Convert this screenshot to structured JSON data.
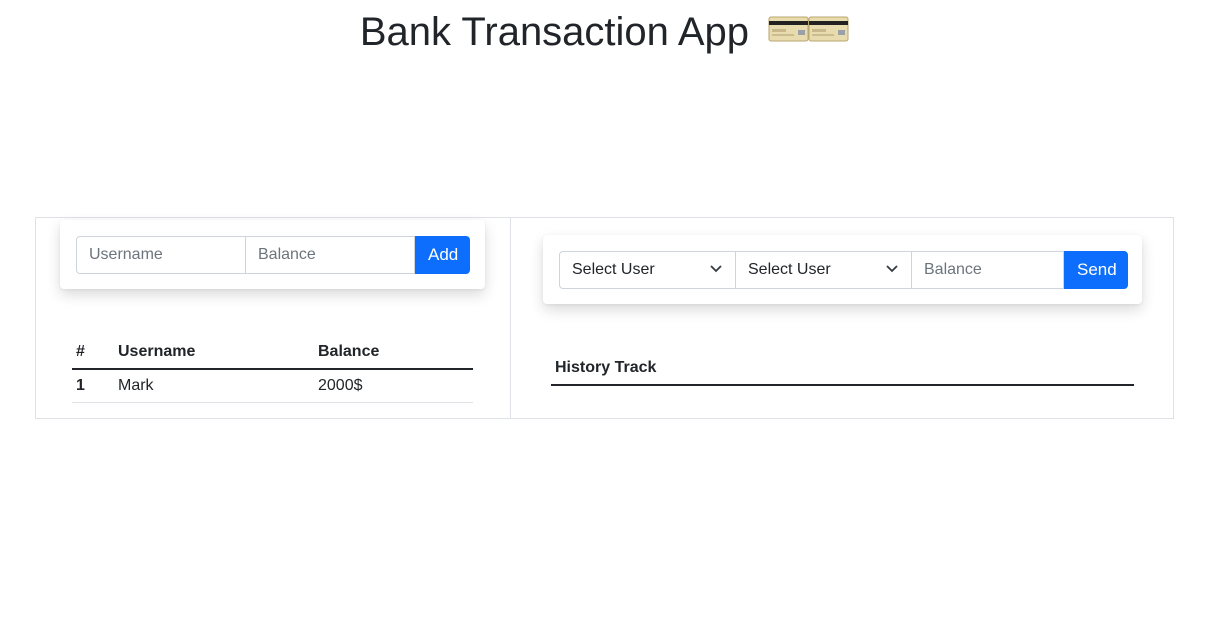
{
  "app": {
    "title": "Bank Transaction App",
    "title_icon": "credit-card-icon"
  },
  "add_form": {
    "username_placeholder": "Username",
    "balance_placeholder": "Balance",
    "add_label": "Add"
  },
  "users_table": {
    "headers": [
      "#",
      "Username",
      "Balance"
    ],
    "rows": [
      {
        "index": "1",
        "username": "Mark",
        "balance": "2000$"
      }
    ]
  },
  "send_form": {
    "from_select": "Select User",
    "to_select": "Select User",
    "balance_placeholder": "Balance",
    "send_label": "Send"
  },
  "history": {
    "header": "History Track"
  },
  "colors": {
    "primary": "#0d6efd",
    "text": "#212529",
    "border": "#dee2e6"
  }
}
